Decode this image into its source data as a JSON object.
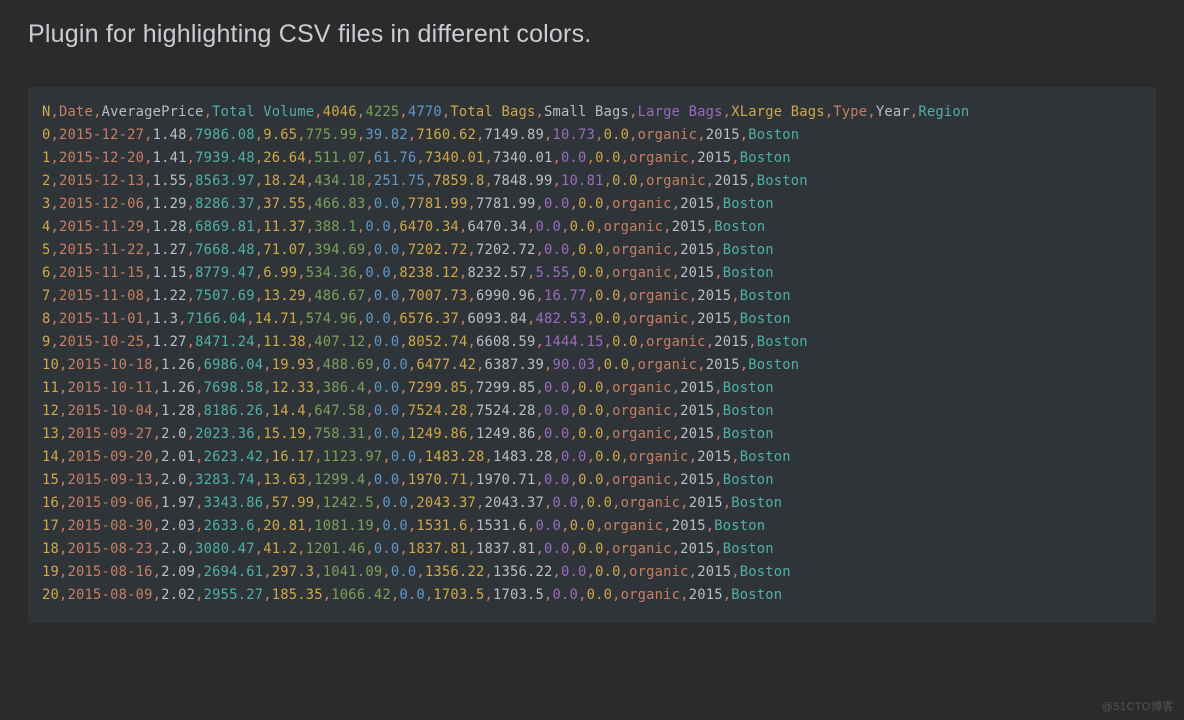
{
  "heading": "Plugin for highlighting CSV files in different colors.",
  "watermark": "@51CTO博客",
  "column_colors": [
    "#d0a84a",
    "#c77f64",
    "#b8bec5",
    "#4fb0a5",
    "#d0a84a",
    "#7aa15a",
    "#5f98c9",
    "#d0a84a",
    "#b8bec5",
    "#9b6bbf",
    "#d0a84a",
    "#c77f64",
    "#b8bec5",
    "#4fb0a5"
  ],
  "comma_color": "#c77f64",
  "csv_rows": [
    [
      "N",
      "Date",
      "AveragePrice",
      "Total Volume",
      "4046",
      "4225",
      "4770",
      "Total Bags",
      "Small Bags",
      "Large Bags",
      "XLarge Bags",
      "Type",
      "Year",
      "Region"
    ],
    [
      "0",
      "2015-12-27",
      "1.48",
      "7986.08",
      "9.65",
      "775.99",
      "39.82",
      "7160.62",
      "7149.89",
      "10.73",
      "0.0",
      "organic",
      "2015",
      "Boston"
    ],
    [
      "1",
      "2015-12-20",
      "1.41",
      "7939.48",
      "26.64",
      "511.07",
      "61.76",
      "7340.01",
      "7340.01",
      "0.0",
      "0.0",
      "organic",
      "2015",
      "Boston"
    ],
    [
      "2",
      "2015-12-13",
      "1.55",
      "8563.97",
      "18.24",
      "434.18",
      "251.75",
      "7859.8",
      "7848.99",
      "10.81",
      "0.0",
      "organic",
      "2015",
      "Boston"
    ],
    [
      "3",
      "2015-12-06",
      "1.29",
      "8286.37",
      "37.55",
      "466.83",
      "0.0",
      "7781.99",
      "7781.99",
      "0.0",
      "0.0",
      "organic",
      "2015",
      "Boston"
    ],
    [
      "4",
      "2015-11-29",
      "1.28",
      "6869.81",
      "11.37",
      "388.1",
      "0.0",
      "6470.34",
      "6470.34",
      "0.0",
      "0.0",
      "organic",
      "2015",
      "Boston"
    ],
    [
      "5",
      "2015-11-22",
      "1.27",
      "7668.48",
      "71.07",
      "394.69",
      "0.0",
      "7202.72",
      "7202.72",
      "0.0",
      "0.0",
      "organic",
      "2015",
      "Boston"
    ],
    [
      "6",
      "2015-11-15",
      "1.15",
      "8779.47",
      "6.99",
      "534.36",
      "0.0",
      "8238.12",
      "8232.57",
      "5.55",
      "0.0",
      "organic",
      "2015",
      "Boston"
    ],
    [
      "7",
      "2015-11-08",
      "1.22",
      "7507.69",
      "13.29",
      "486.67",
      "0.0",
      "7007.73",
      "6990.96",
      "16.77",
      "0.0",
      "organic",
      "2015",
      "Boston"
    ],
    [
      "8",
      "2015-11-01",
      "1.3",
      "7166.04",
      "14.71",
      "574.96",
      "0.0",
      "6576.37",
      "6093.84",
      "482.53",
      "0.0",
      "organic",
      "2015",
      "Boston"
    ],
    [
      "9",
      "2015-10-25",
      "1.27",
      "8471.24",
      "11.38",
      "407.12",
      "0.0",
      "8052.74",
      "6608.59",
      "1444.15",
      "0.0",
      "organic",
      "2015",
      "Boston"
    ],
    [
      "10",
      "2015-10-18",
      "1.26",
      "6986.04",
      "19.93",
      "488.69",
      "0.0",
      "6477.42",
      "6387.39",
      "90.03",
      "0.0",
      "organic",
      "2015",
      "Boston"
    ],
    [
      "11",
      "2015-10-11",
      "1.26",
      "7698.58",
      "12.33",
      "386.4",
      "0.0",
      "7299.85",
      "7299.85",
      "0.0",
      "0.0",
      "organic",
      "2015",
      "Boston"
    ],
    [
      "12",
      "2015-10-04",
      "1.28",
      "8186.26",
      "14.4",
      "647.58",
      "0.0",
      "7524.28",
      "7524.28",
      "0.0",
      "0.0",
      "organic",
      "2015",
      "Boston"
    ],
    [
      "13",
      "2015-09-27",
      "2.0",
      "2023.36",
      "15.19",
      "758.31",
      "0.0",
      "1249.86",
      "1249.86",
      "0.0",
      "0.0",
      "organic",
      "2015",
      "Boston"
    ],
    [
      "14",
      "2015-09-20",
      "2.01",
      "2623.42",
      "16.17",
      "1123.97",
      "0.0",
      "1483.28",
      "1483.28",
      "0.0",
      "0.0",
      "organic",
      "2015",
      "Boston"
    ],
    [
      "15",
      "2015-09-13",
      "2.0",
      "3283.74",
      "13.63",
      "1299.4",
      "0.0",
      "1970.71",
      "1970.71",
      "0.0",
      "0.0",
      "organic",
      "2015",
      "Boston"
    ],
    [
      "16",
      "2015-09-06",
      "1.97",
      "3343.86",
      "57.99",
      "1242.5",
      "0.0",
      "2043.37",
      "2043.37",
      "0.0",
      "0.0",
      "organic",
      "2015",
      "Boston"
    ],
    [
      "17",
      "2015-08-30",
      "2.03",
      "2633.6",
      "20.81",
      "1081.19",
      "0.0",
      "1531.6",
      "1531.6",
      "0.0",
      "0.0",
      "organic",
      "2015",
      "Boston"
    ],
    [
      "18",
      "2015-08-23",
      "2.0",
      "3080.47",
      "41.2",
      "1201.46",
      "0.0",
      "1837.81",
      "1837.81",
      "0.0",
      "0.0",
      "organic",
      "2015",
      "Boston"
    ],
    [
      "19",
      "2015-08-16",
      "2.09",
      "2694.61",
      "297.3",
      "1041.09",
      "0.0",
      "1356.22",
      "1356.22",
      "0.0",
      "0.0",
      "organic",
      "2015",
      "Boston"
    ],
    [
      "20",
      "2015-08-09",
      "2.02",
      "2955.27",
      "185.35",
      "1066.42",
      "0.0",
      "1703.5",
      "1703.5",
      "0.0",
      "0.0",
      "organic",
      "2015",
      "Boston"
    ]
  ]
}
